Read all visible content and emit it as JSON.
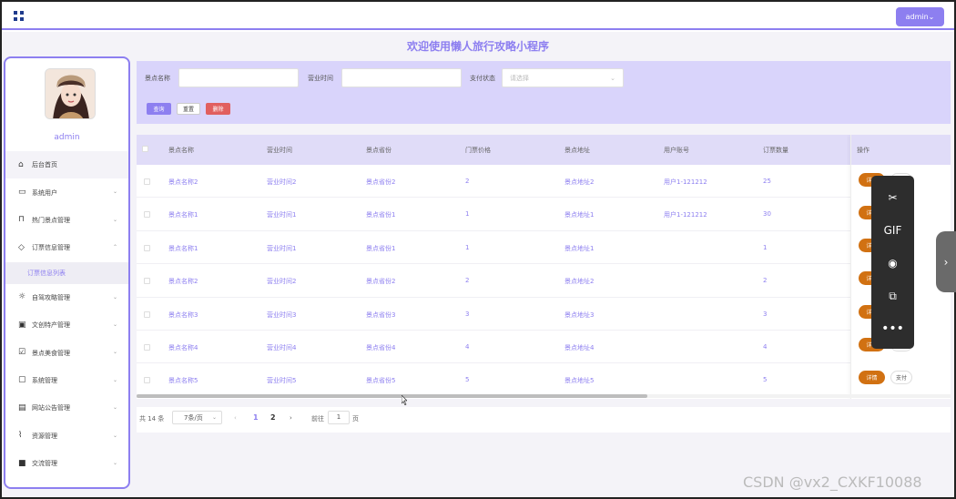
{
  "header": {
    "admin_label": "admin⌄",
    "welcome_title": "欢迎使用懒人旅行攻略小程序"
  },
  "sidebar": {
    "user_name": "admin",
    "items": [
      {
        "label": "后台首页",
        "icon": "home-icon"
      },
      {
        "label": "系统用户",
        "icon": "monitor-icon"
      },
      {
        "label": "热门景点管理",
        "icon": "bookmark-icon"
      },
      {
        "label": "订票信息管理",
        "icon": "tag-icon"
      },
      {
        "label": "订票信息列表",
        "icon": ""
      },
      {
        "label": "自驾攻略管理",
        "icon": "sun-icon"
      },
      {
        "label": "文创特产管理",
        "icon": "inbox-icon"
      },
      {
        "label": "景点美食管理",
        "icon": "clipboard-check-icon"
      },
      {
        "label": "系统管理",
        "icon": "message-icon"
      },
      {
        "label": "网站公告管理",
        "icon": "calendar-icon"
      },
      {
        "label": "资源管理",
        "icon": "paperclip-icon"
      },
      {
        "label": "交流管理",
        "icon": "chat-icon"
      }
    ]
  },
  "search": {
    "name_label": "景点名称",
    "hours_label": "营业时间",
    "pay_label": "支付状态",
    "pay_placeholder": "请选择",
    "query_label": "查询",
    "reset_label": "重置",
    "delete_label": "删除"
  },
  "table": {
    "columns": [
      "景点名称",
      "营业时间",
      "景点省份",
      "门票价格",
      "景点地址",
      "用户账号",
      "订票数量",
      "操作"
    ],
    "rows": [
      {
        "name": "景点名称2",
        "hours": "营业时间2",
        "province": "景点省份2",
        "price": "2",
        "address": "景点地址2",
        "user": "用户1-121212",
        "qty": "25"
      },
      {
        "name": "景点名称1",
        "hours": "营业时间1",
        "province": "景点省份1",
        "price": "1",
        "address": "景点地址1",
        "user": "用户1-121212",
        "qty": "30"
      },
      {
        "name": "景点名称1",
        "hours": "营业时间1",
        "province": "景点省份1",
        "price": "1",
        "address": "景点地址1",
        "user": "",
        "qty": "1"
      },
      {
        "name": "景点名称2",
        "hours": "营业时间2",
        "province": "景点省份2",
        "price": "2",
        "address": "景点地址2",
        "user": "",
        "qty": "2"
      },
      {
        "name": "景点名称3",
        "hours": "营业时间3",
        "province": "景点省份3",
        "price": "3",
        "address": "景点地址3",
        "user": "",
        "qty": "3"
      },
      {
        "name": "景点名称4",
        "hours": "营业时间4",
        "province": "景点省份4",
        "price": "4",
        "address": "景点地址4",
        "user": "",
        "qty": "4"
      },
      {
        "name": "景点名称5",
        "hours": "营业时间5",
        "province": "景点省份5",
        "price": "5",
        "address": "景点地址5",
        "user": "",
        "qty": "5"
      }
    ],
    "detail_label": "详情",
    "pay_label": "支付"
  },
  "pagination": {
    "total": "共 14 条",
    "page_size": "7条/页",
    "pages": [
      "1",
      "2"
    ],
    "goto_label": "前往",
    "jump_value": "1",
    "page_label": "页"
  },
  "toolbar": {
    "gif_label": "GIF",
    "icons": [
      "scissors-icon",
      "gif-icon",
      "record-icon",
      "image-icon",
      "more-icon"
    ]
  },
  "watermark": "CSDN @vx2_CXKF10088",
  "colors": {
    "accent": "#8d7ff0",
    "detail": "#d17112",
    "delete": "#e15f5f"
  }
}
